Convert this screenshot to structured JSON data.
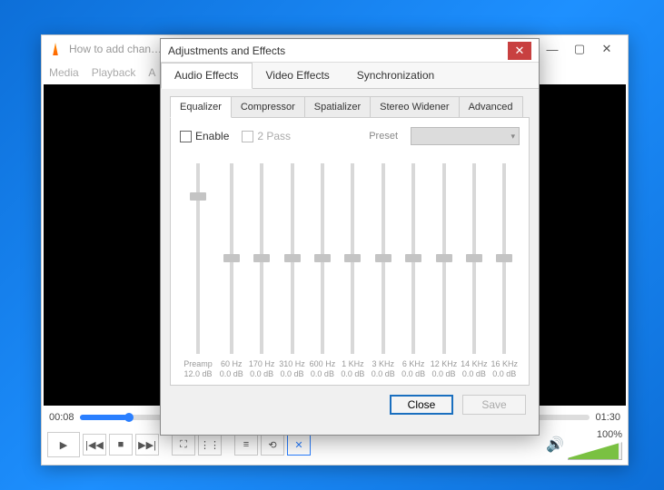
{
  "vlc": {
    "title": "How to add chan…",
    "menu": [
      "Media",
      "Playback",
      "A"
    ],
    "time_current": "00:08",
    "time_total": "01:30",
    "volume_pct": "100%"
  },
  "dialog": {
    "title": "Adjustments and Effects",
    "tabs_main": [
      "Audio Effects",
      "Video Effects",
      "Synchronization"
    ],
    "tabs_sub": [
      "Equalizer",
      "Compressor",
      "Spatializer",
      "Stereo Widener",
      "Advanced"
    ],
    "enable_label": "Enable",
    "twopass_label": "2 Pass",
    "preset_label": "Preset",
    "preamp": {
      "label": "Preamp",
      "db": "12.0 dB",
      "thumb_pct": 16
    },
    "bands": [
      {
        "freq": "60 Hz",
        "db": "0.0 dB",
        "thumb_pct": 50
      },
      {
        "freq": "170 Hz",
        "db": "0.0 dB",
        "thumb_pct": 50
      },
      {
        "freq": "310 Hz",
        "db": "0.0 dB",
        "thumb_pct": 50
      },
      {
        "freq": "600 Hz",
        "db": "0.0 dB",
        "thumb_pct": 50
      },
      {
        "freq": "1 KHz",
        "db": "0.0 dB",
        "thumb_pct": 50
      },
      {
        "freq": "3 KHz",
        "db": "0.0 dB",
        "thumb_pct": 50
      },
      {
        "freq": "6 KHz",
        "db": "0.0 dB",
        "thumb_pct": 50
      },
      {
        "freq": "12 KHz",
        "db": "0.0 dB",
        "thumb_pct": 50
      },
      {
        "freq": "14 KHz",
        "db": "0.0 dB",
        "thumb_pct": 50
      },
      {
        "freq": "16 KHz",
        "db": "0.0 dB",
        "thumb_pct": 50
      }
    ],
    "close_label": "Close",
    "save_label": "Save"
  }
}
